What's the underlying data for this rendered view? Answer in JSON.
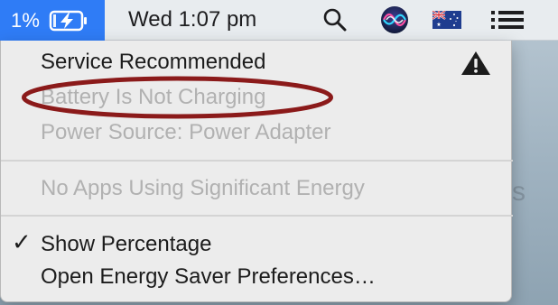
{
  "menubar": {
    "battery_percent": "1%",
    "clock": "Wed 1:07 pm",
    "icons": {
      "battery": "battery-charging-icon",
      "search": "search-icon",
      "siri": "siri-icon",
      "input_source": "australia-flag-icon",
      "control": "list-icon"
    },
    "accent_color": "#2f7cf6"
  },
  "battery_menu": {
    "status_title": "Service Recommended",
    "warning_icon": "warning-icon",
    "charging_status": "Battery Is Not Charging",
    "power_source": "Power Source: Power Adapter",
    "energy_apps": "No Apps Using Significant Energy",
    "show_percentage": {
      "label": "Show Percentage",
      "checked": true
    },
    "open_prefs": "Open Energy Saver Preferences…"
  },
  "annotation": {
    "color": "#8b1a1a",
    "shape": "ellipse"
  },
  "background_fragment": "s"
}
